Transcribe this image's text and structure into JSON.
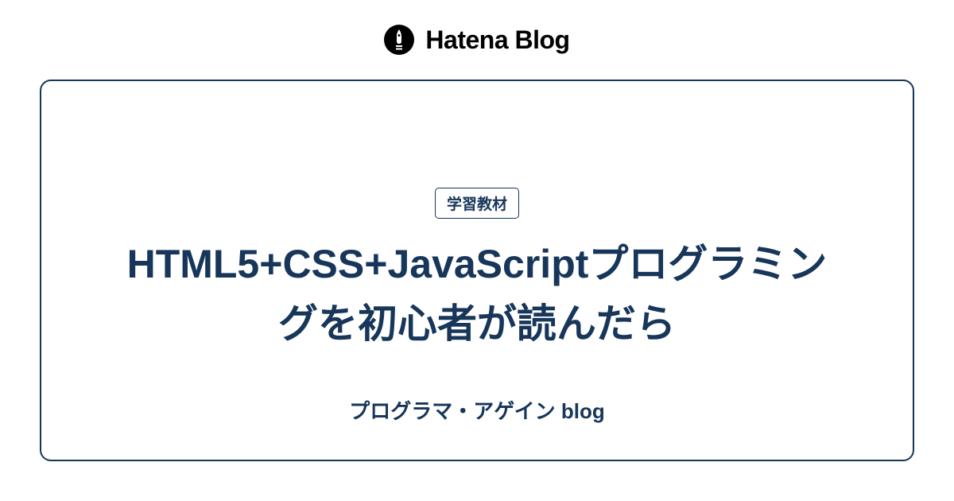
{
  "header": {
    "site_name": "Hatena Blog"
  },
  "card": {
    "category": "学習教材",
    "title": "HTML5+CSS+JavaScriptプログラミングを初心者が読んだら",
    "blog_name": "プログラマ・アゲイン blog"
  },
  "colors": {
    "primary": "#17365a"
  }
}
